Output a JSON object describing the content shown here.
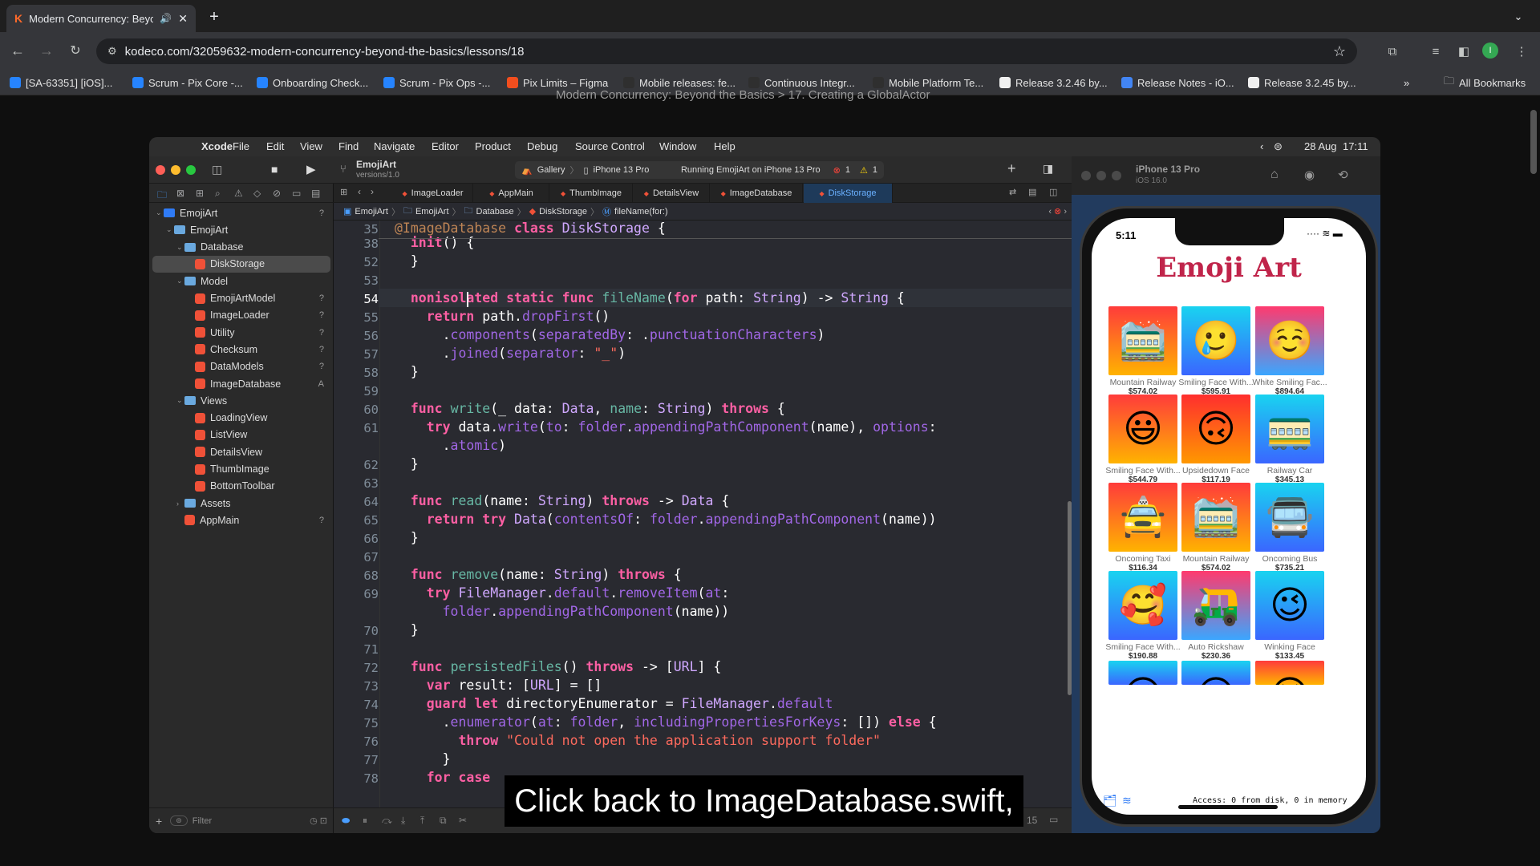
{
  "browser": {
    "tab_title": "Modern Concurrency: Beyo",
    "url": "kodeco.com/32059632-modern-concurrency-beyond-the-basics/lessons/18",
    "bookmarks": [
      {
        "label": "[SA-63351] [iOS]...",
        "color": "#2684ff"
      },
      {
        "label": "Scrum - Pix Core -...",
        "color": "#2684ff"
      },
      {
        "label": "Onboarding Check...",
        "color": "#2684ff"
      },
      {
        "label": "Scrum - Pix Ops -...",
        "color": "#2684ff"
      },
      {
        "label": "Pix Limits – Figma",
        "color": "#f24e1e"
      },
      {
        "label": "Mobile releases: fe...",
        "color": "#2f2f2f"
      },
      {
        "label": "Continuous Integr...",
        "color": "#2f2f2f"
      },
      {
        "label": "Mobile Platform Te...",
        "color": "#2f2f2f"
      },
      {
        "label": "Release 3.2.46 by...",
        "color": "#f0f0f0"
      },
      {
        "label": "Release Notes - iO...",
        "color": "#4285f4"
      },
      {
        "label": "Release 3.2.45 by...",
        "color": "#f0f0f0"
      }
    ],
    "more_bookmarks": "»",
    "all_bookmarks": "All Bookmarks",
    "avatar_letter": "I"
  },
  "page": {
    "breadcrumb": "Modern Concurrency: Beyond the Basics  >  17. Creating a GlobalActor"
  },
  "macos": {
    "menus": [
      "Xcode",
      "File",
      "Edit",
      "View",
      "Find",
      "Navigate",
      "Editor",
      "Product",
      "Debug",
      "Source Control",
      "Window",
      "Help"
    ],
    "date": "28 Aug",
    "time": "17:11"
  },
  "xcode": {
    "project": "EmojiArt",
    "version": "versions/1.0",
    "scheme": "Gallery",
    "device": "iPhone 13 Pro",
    "status": "Running EmojiArt on iPhone 13 Pro",
    "errors": "1",
    "warnings": "1",
    "tabs": [
      "ImageLoader",
      "AppMain",
      "ThumbImage",
      "DetailsView",
      "ImageDatabase",
      "DiskStorage"
    ],
    "jump_bar": [
      "EmojiArt",
      "EmojiArt",
      "Database",
      "DiskStorage",
      "fileName(for:)"
    ],
    "navigator": [
      {
        "label": "EmojiArt",
        "badge": "?"
      },
      {
        "label": "EmojiArt",
        "badge": ""
      },
      {
        "label": "Database",
        "badge": ""
      },
      {
        "label": "DiskStorage",
        "badge": ""
      },
      {
        "label": "Model",
        "badge": ""
      },
      {
        "label": "EmojiArtModel",
        "badge": "?"
      },
      {
        "label": "ImageLoader",
        "badge": "?"
      },
      {
        "label": "Utility",
        "badge": "?"
      },
      {
        "label": "Checksum",
        "badge": "?"
      },
      {
        "label": "DataModels",
        "badge": "?"
      },
      {
        "label": "ImageDatabase",
        "badge": "A"
      },
      {
        "label": "Views",
        "badge": ""
      },
      {
        "label": "LoadingView",
        "badge": ""
      },
      {
        "label": "ListView",
        "badge": ""
      },
      {
        "label": "DetailsView",
        "badge": ""
      },
      {
        "label": "ThumbImage",
        "badge": ""
      },
      {
        "label": "BottomToolbar",
        "badge": ""
      },
      {
        "label": "Assets",
        "badge": ""
      },
      {
        "label": "AppMain",
        "badge": "?"
      }
    ],
    "filter_placeholder": "Filter",
    "line_count": "15",
    "line_numbers": [
      "35",
      "38",
      "52",
      "53",
      "54",
      "55",
      "56",
      "57",
      "58",
      "59",
      "60",
      "61",
      "",
      "62",
      "63",
      "64",
      "65",
      "66",
      "67",
      "68",
      "69",
      "",
      "70",
      "71",
      "72",
      "73",
      "74",
      "75",
      "76",
      "77",
      "78"
    ]
  },
  "simulator": {
    "device": "iPhone 13 Pro",
    "os": "iOS 16.0",
    "clock": "5:11",
    "title": "Emoji Art",
    "footer": "Access: 0 from disk, 0 in memory",
    "items": [
      {
        "name": "Mountain Railway",
        "price": "$574.02",
        "emoji": "🚞",
        "c1": "#ff3b3b",
        "c2": "#ffb300"
      },
      {
        "name": "Smiling Face With...",
        "price": "$595.91",
        "emoji": "🥲",
        "c1": "#19d3f0",
        "c2": "#3a66ff"
      },
      {
        "name": "White Smiling Fac...",
        "price": "$894.64",
        "emoji": "☺️",
        "c1": "#ff3a6e",
        "c2": "#3aa6ff"
      },
      {
        "name": "Smiling Face With...",
        "price": "$544.79",
        "emoji": "😃",
        "c1": "#ff3b3b",
        "c2": "#ffb300"
      },
      {
        "name": "Upsidedown Face",
        "price": "$117.19",
        "emoji": "🙃",
        "c1": "#ff2e2e",
        "c2": "#ff9800"
      },
      {
        "name": "Railway Car",
        "price": "$345.13",
        "emoji": "🚃",
        "c1": "#19d3f0",
        "c2": "#3a66ff"
      },
      {
        "name": "Oncoming Taxi",
        "price": "$116.34",
        "emoji": "🚖",
        "c1": "#ff3b3b",
        "c2": "#ffb300"
      },
      {
        "name": "Mountain Railway",
        "price": "$574.02",
        "emoji": "🚞",
        "c1": "#ff3b3b",
        "c2": "#ffb300"
      },
      {
        "name": "Oncoming Bus",
        "price": "$735.21",
        "emoji": "🚍",
        "c1": "#19d3f0",
        "c2": "#3a66ff"
      },
      {
        "name": "Smiling Face With...",
        "price": "$190.88",
        "emoji": "🥰",
        "c1": "#19d3f0",
        "c2": "#3a66ff"
      },
      {
        "name": "Auto Rickshaw",
        "price": "$230.36",
        "emoji": "🛺",
        "c1": "#ff3a6e",
        "c2": "#3aa6ff"
      },
      {
        "name": "Winking Face",
        "price": "$133.45",
        "emoji": "😉",
        "c1": "#19d3f0",
        "c2": "#3a66ff"
      },
      {
        "name": "",
        "price": "",
        "emoji": "😋",
        "c1": "#19d3f0",
        "c2": "#3a66ff"
      },
      {
        "name": "",
        "price": "",
        "emoji": "😅",
        "c1": "#19d3f0",
        "c2": "#3a66ff"
      },
      {
        "name": "",
        "price": "",
        "emoji": "😝",
        "c1": "#ff3b3b",
        "c2": "#ffb300"
      }
    ]
  },
  "caption": "Click back to ImageDatabase.swift,"
}
